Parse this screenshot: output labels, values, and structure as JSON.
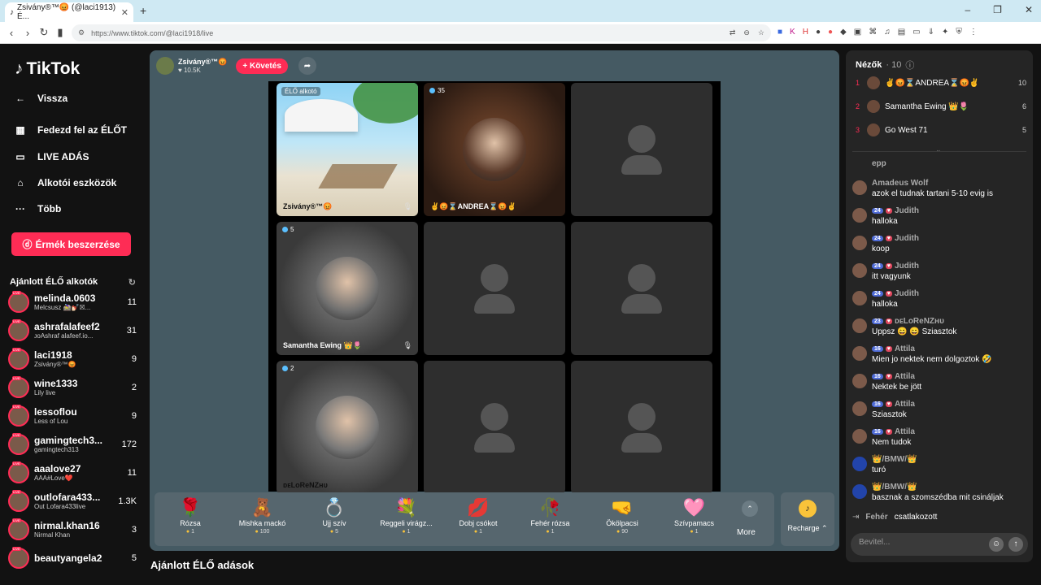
{
  "browser": {
    "tab_title": "Zsivány®™😡 (@laci1913) É...",
    "new_tab": "+",
    "url": "https://www.tiktok.com/@laci1918/live"
  },
  "sidebar": {
    "logo": "TikTok",
    "nav": [
      {
        "label": "Vissza",
        "icon": "arrow-left-icon"
      },
      {
        "label": "Fedezd fel az ÉLŐT",
        "icon": "calendar-icon"
      },
      {
        "label": "LIVE ADÁS",
        "icon": "camera-icon"
      },
      {
        "label": "Alkotói eszközök",
        "icon": "house-icon"
      },
      {
        "label": "Több",
        "icon": "more-icon"
      }
    ],
    "coins_button": "Érmék beszerzése",
    "recommended_header": "Ajánlott ÉLŐ alkotók",
    "creators": [
      {
        "name": "melinda.0603",
        "sub": "Melcsusz 🚵‍♀️💅🏻☒...",
        "count": "11"
      },
      {
        "name": "ashrafalafeef2",
        "sub": "ᴊᴏAshraf alafeef.io...",
        "count": "31"
      },
      {
        "name": "laci1918",
        "sub": "Zsivány®™😡",
        "count": "9"
      },
      {
        "name": "wine1333",
        "sub": "Lily live",
        "count": "2"
      },
      {
        "name": "lessoflou",
        "sub": "Less of Lou",
        "count": "9"
      },
      {
        "name": "gamingtech3...",
        "sub": "gamingtech313",
        "count": "172"
      },
      {
        "name": "aaalove27",
        "sub": "AAA#Love❤️",
        "count": "11"
      },
      {
        "name": "outlofara433...",
        "sub": "Out Lofara433live",
        "count": "1.3K"
      },
      {
        "name": "nirmal.khan16",
        "sub": "Nirmal Khan",
        "count": "3"
      },
      {
        "name": "beautyangela2",
        "sub": "",
        "count": "5"
      }
    ]
  },
  "stream": {
    "host_name": "Zsivány®™😡",
    "host_likes": "10.5K",
    "follow_label": "+ Követés",
    "cells": [
      {
        "type": "beach",
        "tag": "ÉLŐ alkotó",
        "name": "Zsivány®™😡",
        "mic_off": true
      },
      {
        "type": "face",
        "viewers": "35",
        "name": "✌😡⌛ANDREA⌛😡✌",
        "mic_off": false
      },
      {
        "type": "empty"
      },
      {
        "type": "face",
        "viewers": "5",
        "name": "Samantha Ewing 👑🌷",
        "mic_off": true
      },
      {
        "type": "empty"
      },
      {
        "type": "empty"
      },
      {
        "type": "face",
        "viewers": "2",
        "name": "ᴅᴇLoReNZʜᴜ",
        "mic_off": false
      },
      {
        "type": "empty"
      },
      {
        "type": "empty"
      }
    ]
  },
  "gifts": [
    {
      "icon": "🌹",
      "name": "Rózsa",
      "price": "1"
    },
    {
      "icon": "🧸",
      "name": "Mishka mackó",
      "price": "100"
    },
    {
      "icon": "💍",
      "name": "Ujj szív",
      "price": "5"
    },
    {
      "icon": "💐",
      "name": "Reggeli virágz...",
      "price": "1"
    },
    {
      "icon": "💋",
      "name": "Dobj csókot",
      "price": "1"
    },
    {
      "icon": "🥀",
      "name": "Fehér rózsa",
      "price": "1"
    },
    {
      "icon": "🤜",
      "name": "Ökölpacsi",
      "price": "90"
    },
    {
      "icon": "🩷",
      "name": "Szívpamacs",
      "price": "1"
    }
  ],
  "more_label": "More",
  "recharge_label": "Recharge",
  "bottom_title": "Ajánlott ÉLŐ adások",
  "viewers": {
    "title": "Nézők",
    "count": "· 10",
    "list": [
      {
        "rank": "1",
        "name": "✌😡⌛ANDREA⌛😡✌",
        "count": "10"
      },
      {
        "rank": "2",
        "name": "Samantha Ewing 👑🌷",
        "count": "6"
      },
      {
        "rank": "3",
        "name": "Go West 71",
        "count": "5"
      }
    ]
  },
  "chat": [
    {
      "name": "epp",
      "text": "",
      "badges": ""
    },
    {
      "name": "Amadeus Wolf",
      "text": "azok el tudnak tartani 5-10 evig is",
      "badges": ""
    },
    {
      "name": "Judith",
      "text": "halloka",
      "badges": "24"
    },
    {
      "name": "Judith",
      "text": "koop",
      "badges": "24"
    },
    {
      "name": "Judith",
      "text": "itt vagyunk",
      "badges": "24"
    },
    {
      "name": "Judith",
      "text": "halloka",
      "badges": "24"
    },
    {
      "name": "ᴅᴇLoReNZʜᴜ",
      "text": "Uppsz 😄 😄 Sziasztok",
      "badges": "23"
    },
    {
      "name": "Attila",
      "text": "Mien jo nektek nem dolgoztok 🤣",
      "badges": "16"
    },
    {
      "name": "Attila",
      "text": "Nektek be jött",
      "badges": "16"
    },
    {
      "name": "Attila",
      "text": "Sziasztok",
      "badges": "16"
    },
    {
      "name": "Attila",
      "text": "Nem tudok",
      "badges": "16"
    },
    {
      "name": "👑/BMW/👑",
      "text": "turó",
      "badges": ""
    },
    {
      "name": "👑/BMW/👑",
      "text": "basznak a szomszédba mit csináljak",
      "badges": ""
    }
  ],
  "joined": {
    "name": "Fehér",
    "text": "csatlakozott"
  },
  "input_placeholder": "Bevitel..."
}
